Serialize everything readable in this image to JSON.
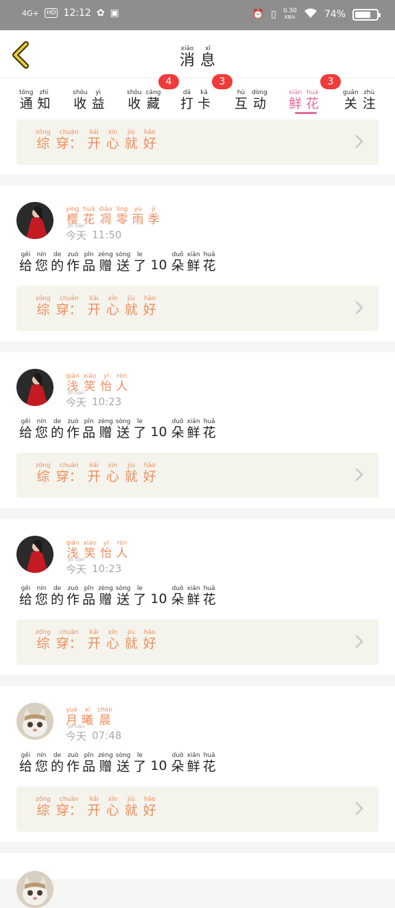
{
  "status": {
    "network": "4G+",
    "hd": "HD",
    "time": "12:12",
    "speed_top": "0.30",
    "speed_bottom": "KB/s",
    "battery": "74%",
    "battery_level": 0.74
  },
  "header": {
    "title": [
      {
        "py": "xiāo",
        "hz": "消"
      },
      {
        "py": "xī",
        "hz": "息"
      }
    ]
  },
  "tabs": [
    {
      "chars": [
        {
          "py": "tōng",
          "hz": "通"
        },
        {
          "py": "zhī",
          "hz": "知"
        }
      ]
    },
    {
      "chars": [
        {
          "py": "shōu",
          "hz": "收"
        },
        {
          "py": "yì",
          "hz": "益"
        }
      ]
    },
    {
      "chars": [
        {
          "py": "shōu",
          "hz": "收"
        },
        {
          "py": "cáng",
          "hz": "藏"
        }
      ],
      "badge": "4"
    },
    {
      "chars": [
        {
          "py": "dǎ",
          "hz": "打"
        },
        {
          "py": "kǎ",
          "hz": "卡"
        }
      ],
      "badge": "3"
    },
    {
      "chars": [
        {
          "py": "hù",
          "hz": "互"
        },
        {
          "py": "dòng",
          "hz": "动"
        }
      ]
    },
    {
      "chars": [
        {
          "py": "xiān",
          "hz": "鲜"
        },
        {
          "py": "huā",
          "hz": "花"
        }
      ],
      "badge": "3",
      "active": true
    },
    {
      "chars": [
        {
          "py": "guān",
          "hz": "关"
        },
        {
          "py": "zhù",
          "hz": "注"
        }
      ]
    }
  ],
  "work_title": [
    {
      "py": "zōng",
      "hz": "综"
    },
    {
      "py": "chuān",
      "hz": "穿："
    },
    {
      "py": "kāi",
      "hz": "开"
    },
    {
      "py": "xīn",
      "hz": "心"
    },
    {
      "py": "jiù",
      "hz": "就"
    },
    {
      "py": "hǎo",
      "hz": "好"
    }
  ],
  "today": {
    "py": "jīn tiān",
    "hz": "今天"
  },
  "message": {
    "before": [
      {
        "py": "gěi",
        "hz": "给"
      },
      {
        "py": "nín",
        "hz": "您"
      },
      {
        "py": "de",
        "hz": "的"
      },
      {
        "py": "zuò",
        "hz": "作"
      },
      {
        "py": "pǐn",
        "hz": "品"
      },
      {
        "py": "zèng",
        "hz": "赠"
      },
      {
        "py": "sòng",
        "hz": "送"
      },
      {
        "py": "le",
        "hz": "了"
      }
    ],
    "count": "10",
    "after": [
      {
        "py": "duǒ",
        "hz": "朵"
      },
      {
        "py": "xiān",
        "hz": "鲜"
      },
      {
        "py": "huā",
        "hz": "花"
      }
    ]
  },
  "items": [
    {
      "user": [
        {
          "py": "yīng",
          "hz": "樱"
        },
        {
          "py": "huā",
          "hz": "花"
        },
        {
          "py": "diāo",
          "hz": "凋"
        },
        {
          "py": "líng",
          "hz": "零"
        },
        {
          "py": "yǔ",
          "hz": "雨"
        },
        {
          "py": "jì",
          "hz": "季"
        }
      ],
      "time": "11:50",
      "avatar_icon": "woman-red-dress-avatar"
    },
    {
      "user": [
        {
          "py": "qiǎn",
          "hz": "浅"
        },
        {
          "py": "xiào",
          "hz": "笑"
        },
        {
          "py": "yí",
          "hz": "怡"
        },
        {
          "py": "rén",
          "hz": "人"
        }
      ],
      "time": "10:23",
      "avatar_icon": "woman-red-dress-avatar"
    },
    {
      "user": [
        {
          "py": "qiǎn",
          "hz": "浅"
        },
        {
          "py": "xiào",
          "hz": "笑"
        },
        {
          "py": "yí",
          "hz": "怡"
        },
        {
          "py": "rén",
          "hz": "人"
        }
      ],
      "time": "10:23",
      "avatar_icon": "woman-red-dress-avatar"
    },
    {
      "user": [
        {
          "py": "yuè",
          "hz": "月"
        },
        {
          "py": "xī",
          "hz": "曦"
        },
        {
          "py": "chén",
          "hz": "晨"
        }
      ],
      "time": "07:48",
      "avatar_icon": "cat-avatar"
    }
  ],
  "colors": {
    "accent": "#e06a98",
    "orange": "#ee8d5c",
    "badge": "#ef3b3b",
    "work_bg": "#f4f3ec",
    "back_arrow": "#e8c93a"
  }
}
